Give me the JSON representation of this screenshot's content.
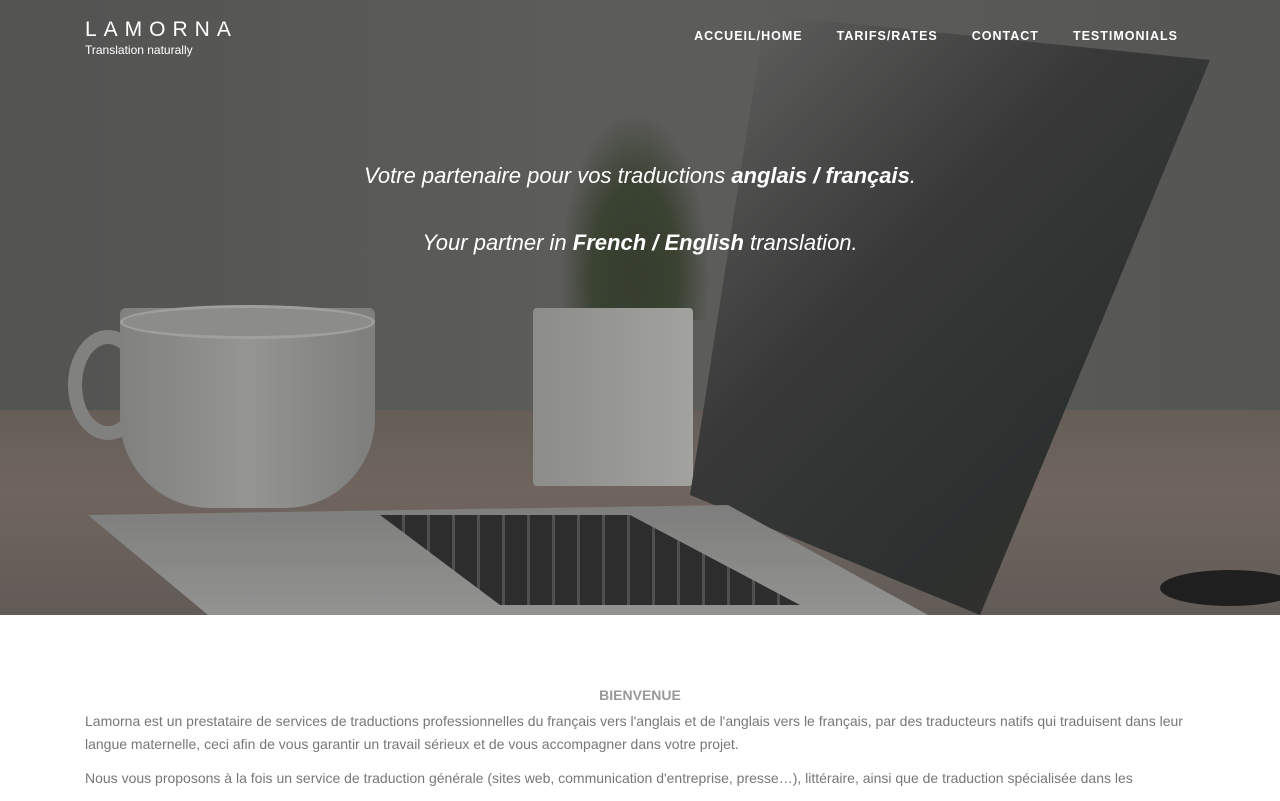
{
  "brand": {
    "name": "LAMORNA",
    "tagline": "Translation naturally"
  },
  "nav": [
    {
      "label": "ACCUEIL/HOME"
    },
    {
      "label": "TARIFS/RATES"
    },
    {
      "label": "CONTACT"
    },
    {
      "label": "TESTIMONIALS"
    }
  ],
  "hero": {
    "fr": {
      "before": "Votre partenaire pour vos traductions ",
      "bold": "anglais / français",
      "after": "."
    },
    "en": {
      "before": "Your partner in ",
      "bold": "French / English",
      "after": " translation."
    }
  },
  "welcome": {
    "heading": "BIENVENUE",
    "paragraphs": [
      "Lamorna est un prestataire de services de traductions professionnelles du français vers l'anglais et de l'anglais vers le français, par des traducteurs natifs qui traduisent dans leur langue maternelle, ceci afin de vous garantir un travail sérieux et de vous accompagner dans votre projet.",
      "Nous vous proposons à la fois un service de traduction générale (sites web, communication d'entreprise, presse…), littéraire, ainsi que de traduction spécialisée dans les"
    ]
  }
}
